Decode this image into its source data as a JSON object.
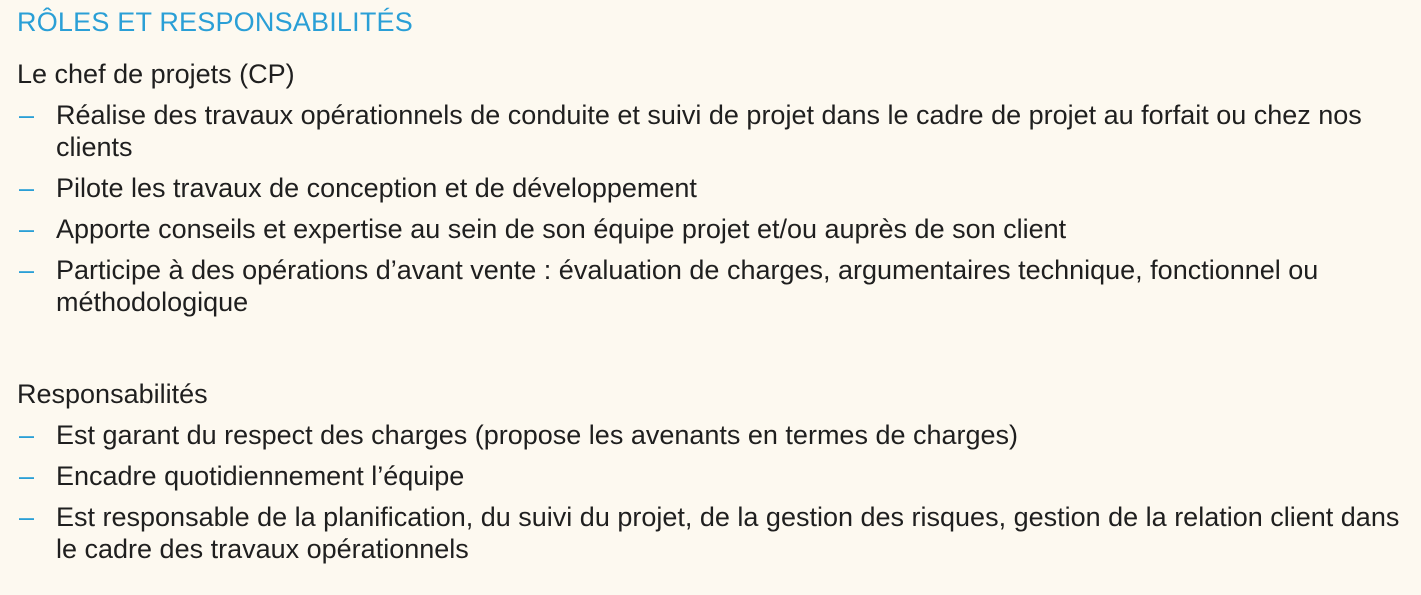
{
  "title": "RÔLES ET RESPONSABILITÉS",
  "sections": [
    {
      "heading": "Le chef de projets (CP)",
      "items": [
        "Réalise des travaux opérationnels de conduite et suivi de projet dans le cadre de projet au forfait ou chez nos clients",
        "Pilote les travaux de conception et de développement",
        "Apporte conseils et expertise au sein de son équipe projet et/ou auprès de son client",
        "Participe à des opérations d’avant vente : évaluation de charges, argumentaires technique, fonctionnel ou méthodologique"
      ]
    },
    {
      "heading": "Responsabilités",
      "items": [
        "Est garant du respect des charges (propose les avenants en termes de charges)",
        "Encadre quotidiennement l’équipe",
        "Est responsable de la  planification, du suivi du projet, de la gestion des risques, gestion de la relation client dans le cadre des travaux opérationnels"
      ]
    }
  ],
  "colors": {
    "background": "#fdf9f0",
    "accent": "#2a9fd6",
    "text": "#1f1f1f"
  }
}
